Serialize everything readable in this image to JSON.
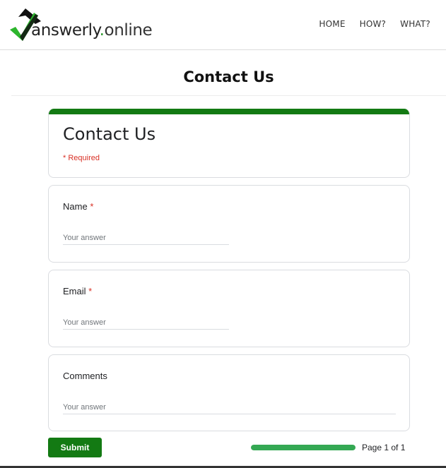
{
  "site": {
    "logo_word": "answerly",
    "logo_dot": ".",
    "logo_tld": "online",
    "nav": [
      {
        "label": "HOME"
      },
      {
        "label": "HOW?"
      },
      {
        "label": "WHAT?"
      }
    ]
  },
  "page": {
    "title": "Contact Us"
  },
  "form": {
    "title": "Contact Us",
    "required_note": "* Required",
    "questions": [
      {
        "label": "Name",
        "required_mark": "*",
        "placeholder": "Your answer"
      },
      {
        "label": "Email",
        "required_mark": "*",
        "placeholder": "Your answer"
      },
      {
        "label": "Comments",
        "placeholder": "Your answer"
      }
    ],
    "submit_label": "Submit",
    "progress_fraction": 1.0,
    "page_indicator": "Page 1 of 1"
  },
  "colors": {
    "accent_green": "#137a13",
    "progress_green": "#34a853",
    "required_red": "#d93025"
  }
}
